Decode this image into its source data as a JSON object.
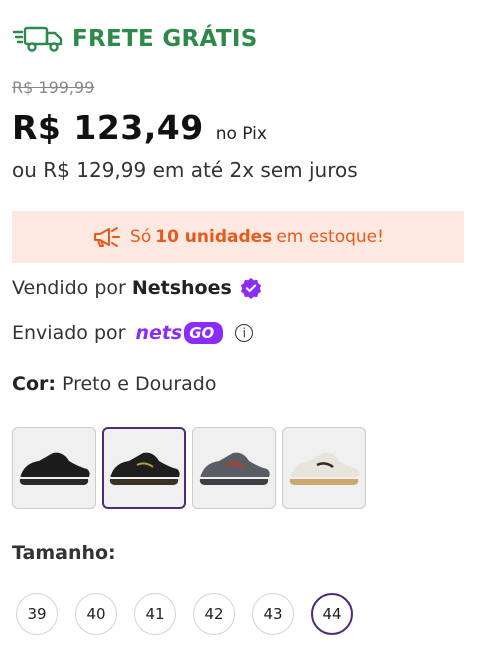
{
  "shipping": {
    "label": "FRETE GRÁTIS",
    "icon": "truck-icon",
    "color": "#2e8a4a"
  },
  "price": {
    "old": "R$ 199,99",
    "current": "R$ 123,49",
    "pix_label": "no Pix",
    "installments": "ou R$ 129,99 em até 2x sem juros"
  },
  "stock": {
    "prefix": "Só",
    "count": "10 unidades",
    "suffix": "em estoque!",
    "icon": "megaphone-icon",
    "color": "#e85a1b"
  },
  "seller": {
    "label": "Vendido por",
    "name": "Netshoes",
    "badge_icon": "verified-badge-icon"
  },
  "shipped": {
    "label": "Enviado por",
    "logo_nets": "nets",
    "logo_go": "GO",
    "info_icon": "info-icon"
  },
  "color": {
    "label": "Cor:",
    "value": "Preto e Dourado",
    "options": [
      {
        "name": "Preto",
        "selected": false
      },
      {
        "name": "Preto e Dourado",
        "selected": true
      },
      {
        "name": "Cinza e Vermelho",
        "selected": false
      },
      {
        "name": "Branco e Dourado",
        "selected": false
      }
    ]
  },
  "size": {
    "label": "Tamanho:",
    "options": [
      "39",
      "40",
      "41",
      "42",
      "43",
      "44"
    ],
    "selected": "44"
  },
  "accent": "#4b2b7f"
}
